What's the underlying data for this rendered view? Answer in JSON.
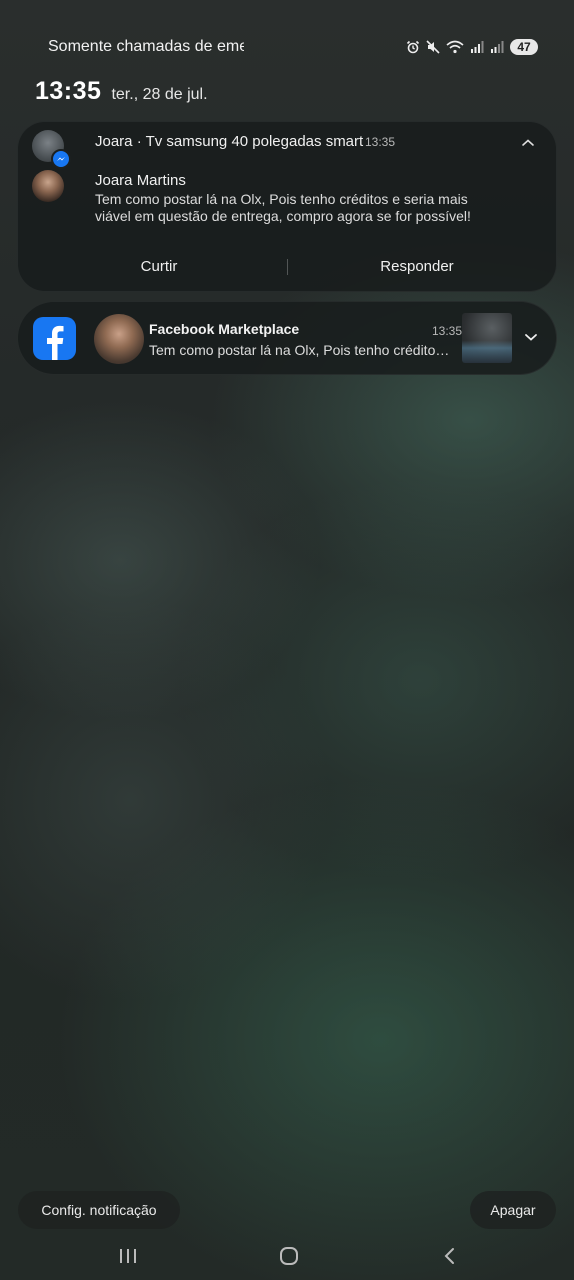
{
  "status_bar": {
    "text": "Somente chamadas de emergência",
    "battery": "47",
    "icons": [
      "alarm-icon",
      "mute-icon",
      "wifi-icon",
      "signal-icon",
      "signal-icon"
    ]
  },
  "clock": {
    "time": "13:35",
    "date": "ter., 28 de jul."
  },
  "notifications": [
    {
      "app": "Messenger",
      "header": "Joara · Tv samsung 40 polegadas smart",
      "time": "13:35",
      "sender": "Joara Martins",
      "message": "Tem como postar lá na Olx, Pois tenho créditos e seria mais viável em questão de entrega, compro agora se for possível!",
      "actions": [
        "Curtir",
        "Responder"
      ]
    },
    {
      "app": "Facebook",
      "title": "Facebook Marketplace",
      "time": "13:35",
      "message": "Tem como postar lá na Olx, Pois tenho créditos e seria mais viável em questão de entrega, compro agora se for possível!"
    }
  ],
  "bottom": {
    "settings_label": "Config. notificação",
    "clear_label": "Apagar"
  },
  "colors": {
    "facebook_blue": "#1877f2",
    "card_background": "#181c1c"
  }
}
